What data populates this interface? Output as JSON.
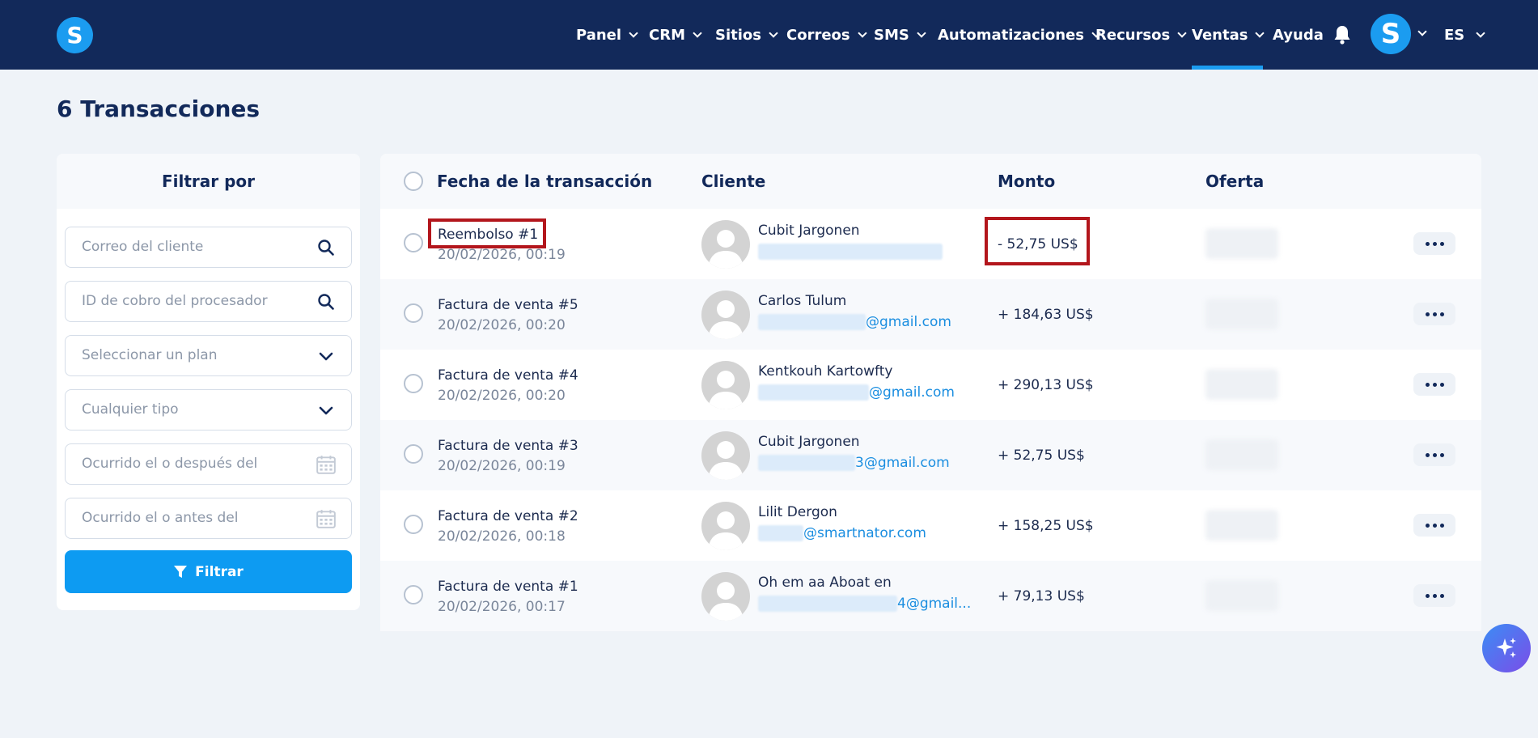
{
  "brand": {
    "logo_letter": "S",
    "accent": "#1b9cf0",
    "navy": "#12295a"
  },
  "nav": {
    "items": [
      {
        "label": "Panel"
      },
      {
        "label": "CRM"
      },
      {
        "label": "Sitios"
      },
      {
        "label": "Correos"
      },
      {
        "label": "SMS"
      },
      {
        "label": "Automatizaciones"
      },
      {
        "label": "Recursos"
      },
      {
        "label": "Ventas",
        "active": true
      },
      {
        "label": "Ayuda"
      }
    ],
    "avatar_letter": "S",
    "language": "ES"
  },
  "page": {
    "title": "6 Transacciones"
  },
  "filter": {
    "title": "Filtrar por",
    "customer_email_placeholder": "Correo del cliente",
    "processor_id_placeholder": "ID de cobro del procesador",
    "plan_placeholder": "Seleccionar un plan",
    "type_placeholder": "Cualquier tipo",
    "after_placeholder": "Ocurrido el o después del",
    "before_placeholder": "Ocurrido el o antes del",
    "button_label": "Filtrar"
  },
  "table": {
    "headers": {
      "date": "Fecha de la transacción",
      "customer": "Cliente",
      "amount": "Monto",
      "offer": "Oferta"
    },
    "rows": [
      {
        "title": "Reembolso #1",
        "date": "20/02/2026, 00:19",
        "customer": "Cubit Jargonen",
        "email_visible": "",
        "amount": "- 52,75 US$"
      },
      {
        "title": "Factura de venta #5",
        "date": "20/02/2026, 00:20",
        "customer": "Carlos Tulum",
        "email_visible": "@gmail.com",
        "amount": "+ 184,63 US$"
      },
      {
        "title": "Factura de venta #4",
        "date": "20/02/2026, 00:20",
        "customer": "Kentkouh Kartowfty",
        "email_visible": "@gmail.com",
        "amount": "+ 290,13 US$"
      },
      {
        "title": "Factura de venta #3",
        "date": "20/02/2026, 00:19",
        "customer": "Cubit Jargonen",
        "email_visible": "3@gmail.com",
        "amount": "+ 52,75 US$"
      },
      {
        "title": "Factura de venta #2",
        "date": "20/02/2026, 00:18",
        "customer": "Lilit Dergon",
        "email_visible": "@smartnator.com",
        "amount": "+ 158,25 US$"
      },
      {
        "title": "Factura de venta #1",
        "date": "20/02/2026, 00:17",
        "customer": "Oh em aa Aboat en",
        "email_visible": "4@gmail...",
        "amount": "+ 79,13 US$"
      }
    ]
  }
}
